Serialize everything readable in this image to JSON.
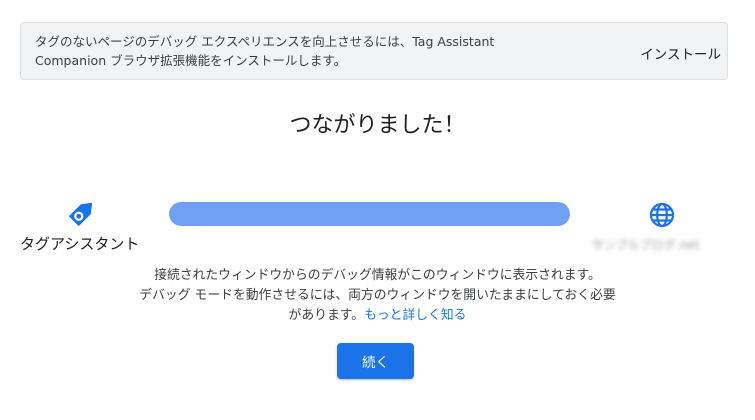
{
  "banner": {
    "message_line1": "タグのないページのデバッグ エクスペリエンスを向上させるには、Tag Assistant",
    "message_line2": "Companion ブラウザ拡張機能をインストールします。",
    "install_label": "インストール"
  },
  "title": "つながりました！",
  "connection": {
    "left_label": "タグアシスタント",
    "right_label": "サンプルブログ.net",
    "progress_percent": 100,
    "left_icon": "tag-assistant-icon",
    "right_icon": "globe-icon"
  },
  "description": {
    "line1": "接続されたウィンドウからのデバッグ情報がこのウィンドウに表示されます。",
    "line2": "デバッグ モードを動作させるには、両方のウィンドウを開いたままにしておく必要",
    "line3_prefix": "があります。",
    "learn_more_label": "もっと詳しく知る"
  },
  "continue_label": "続く",
  "colors": {
    "accent": "#1a73e8",
    "progress": "#6fa0f4",
    "banner_bg": "#f1f3f4"
  }
}
